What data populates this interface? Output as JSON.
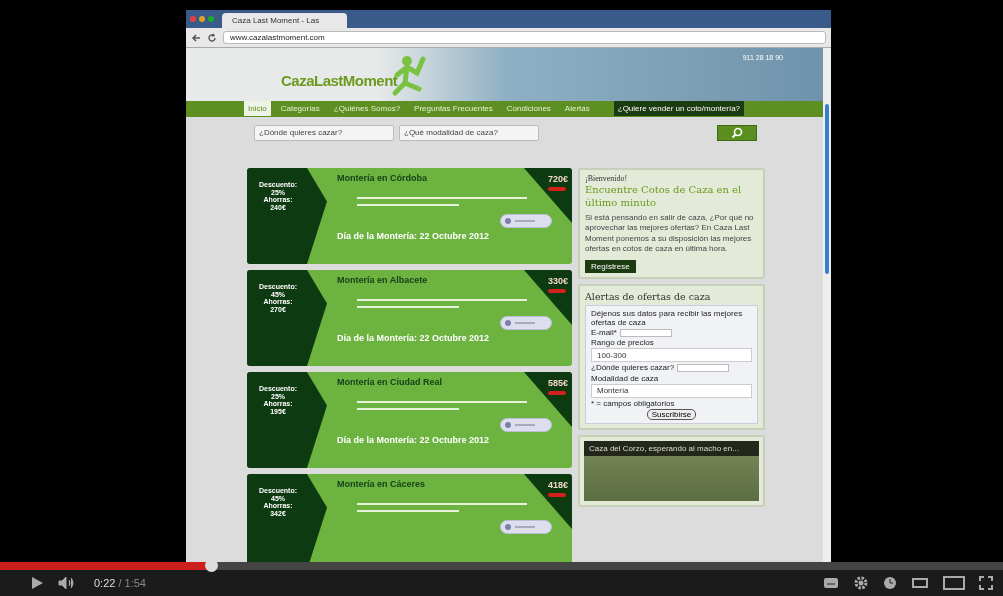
{
  "browser": {
    "tab_title": "Caza Last Moment - Las",
    "url": "www.cazalastmoment.com"
  },
  "header": {
    "logo": "CazaLastMoment",
    "phone": "911 28 18 90"
  },
  "nav": {
    "items": [
      {
        "label": "Inicio",
        "selected": true
      },
      {
        "label": "Categorías",
        "selected": false
      },
      {
        "label": "¿Quiénes Somos?",
        "selected": false
      },
      {
        "label": "Preguntas Frecuentes",
        "selected": false
      },
      {
        "label": "Condiciones",
        "selected": false
      },
      {
        "label": "Alertas",
        "selected": false
      }
    ],
    "cta": "¿Quiere vender un coto/montería?"
  },
  "search": {
    "where": "¿Dónde quieres cazar?",
    "mode": "¿Qué modalidad de caza?"
  },
  "offers": [
    {
      "title": "Montería en Córdoba",
      "discount_label": "Descuento:",
      "discount": "25%",
      "savings_label": "Ahorras:",
      "savings": "240€",
      "price": "720€",
      "date": "Día de la Montería: 22 Octubre 2012"
    },
    {
      "title": "Montería en Albacete",
      "discount_label": "Descuento:",
      "discount": "45%",
      "savings_label": "Ahorras:",
      "savings": "270€",
      "price": "330€",
      "date": "Día de la Montería: 22 Octubre 2012"
    },
    {
      "title": "Montería en Ciudad Real",
      "discount_label": "Descuento:",
      "discount": "25%",
      "savings_label": "Ahorras:",
      "savings": "195€",
      "price": "585€",
      "date": "Día de la Montería: 22 Octubre 2012"
    },
    {
      "title": "Montería en Cáceres",
      "discount_label": "Descuento:",
      "discount": "45%",
      "savings_label": "Ahorras:",
      "savings": "342€",
      "price": "418€"
    }
  ],
  "welcome": {
    "greeting": "¡Bienvenido!",
    "heading": "Encuentre Cotos de Caza en el último minuto",
    "text": "Si está pensando en salir de caza, ¿Por qué no aprovechar las mejores ofertas? En Caza Last Moment ponemos a su disposición las mejores ofertas en cotos de caza en última hora.",
    "button": "Regístrese"
  },
  "alerts": {
    "title": "Alertas de ofertas de caza",
    "intro": "Déjenos sus datos para recibir las mejores ofertas de caza",
    "email_label": "E-mail*",
    "price_label": "Rango de precios",
    "price_value": "100-300",
    "where_label": "¿Dónde quieres cazar?",
    "mode_label": "Modalidad de caza",
    "mode_value": "Montería",
    "required_note": "* = campos obligatorios",
    "button": "Suscribirse"
  },
  "video": {
    "title": "Caza del Corzo, esperando al macho en..."
  },
  "player": {
    "level": 0.21,
    "current": "0:22",
    "duration": "/ 1:54"
  }
}
